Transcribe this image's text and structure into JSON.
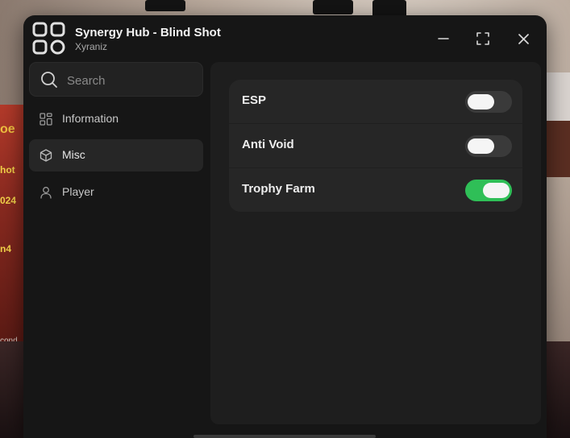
{
  "window": {
    "title": "Synergy Hub - Blind Shot",
    "subtitle": "Xyraniz"
  },
  "search": {
    "placeholder": "Search",
    "value": ""
  },
  "sidebar": {
    "items": [
      {
        "label": "Information",
        "icon": "grid-icon",
        "active": false
      },
      {
        "label": "Misc",
        "icon": "cube-icon",
        "active": true
      },
      {
        "label": "Player",
        "icon": "user-icon",
        "active": false
      }
    ]
  },
  "settings": [
    {
      "label": "ESP",
      "enabled": false
    },
    {
      "label": "Anti Void",
      "enabled": false
    },
    {
      "label": "Trophy Farm",
      "enabled": true
    }
  ],
  "background": {
    "left_sign_text": [
      "oe",
      "hot",
      "024",
      "n4",
      "cond"
    ]
  },
  "colors": {
    "window_bg": "#161616",
    "panel_bg": "#1e1e1e",
    "toggle_on": "#2fbf57",
    "toggle_off": "#3a3a3a"
  }
}
